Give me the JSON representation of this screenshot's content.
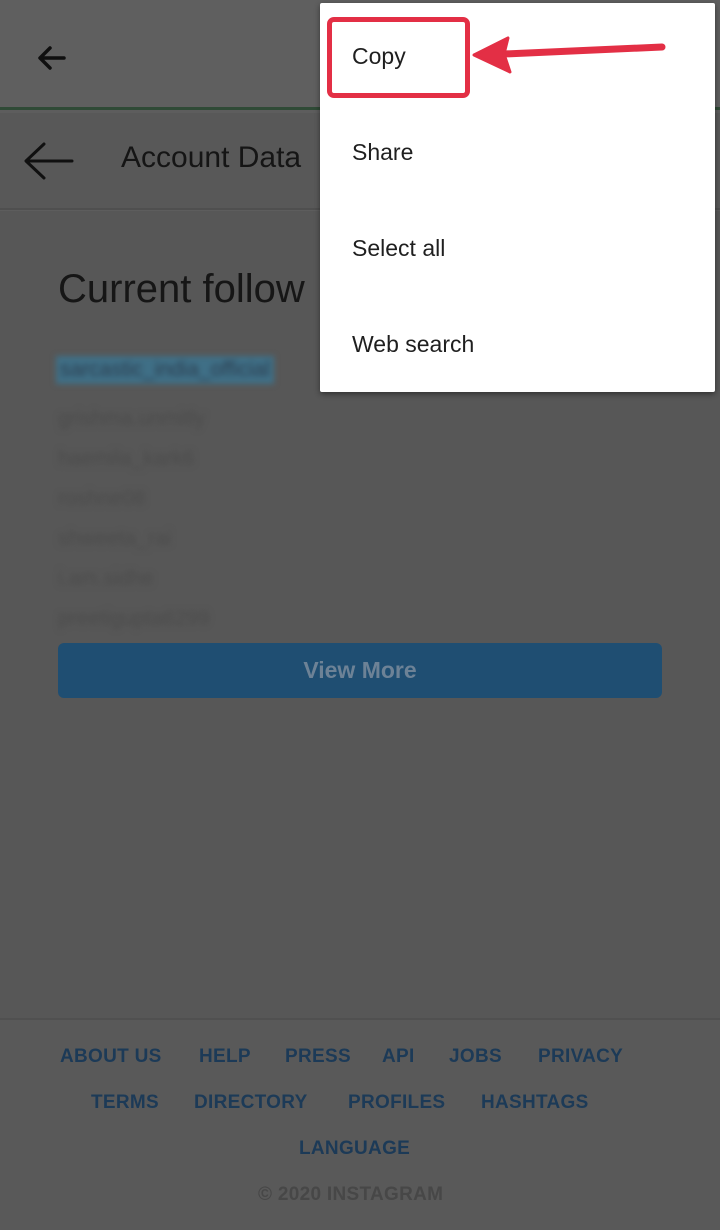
{
  "browser": {
    "back_icon": "arrow-left-icon"
  },
  "header": {
    "back_icon": "arrow-left-icon",
    "title": "Account Data"
  },
  "section": {
    "heading": "Current follow",
    "usernames": [
      "sarcastic_india_official",
      "grishma.unmitly",
      "haemila_kark6",
      "roshne08",
      "shweeta_rai",
      "i.am.sidhe",
      "preetigupta6299"
    ],
    "view_more_label": "View More"
  },
  "footer": {
    "links": [
      "ABOUT US",
      "HELP",
      "PRESS",
      "API",
      "JOBS",
      "PRIVACY",
      "TERMS",
      "DIRECTORY",
      "PROFILES",
      "HASHTAGS",
      "LANGUAGE"
    ],
    "copyright": "© 2020 INSTAGRAM"
  },
  "context_menu": {
    "items": [
      "Copy",
      "Share",
      "Select all",
      "Web search"
    ]
  },
  "colors": {
    "annotation": "#e32f45",
    "link": "#1c3a57",
    "button": "#1f4e72"
  }
}
